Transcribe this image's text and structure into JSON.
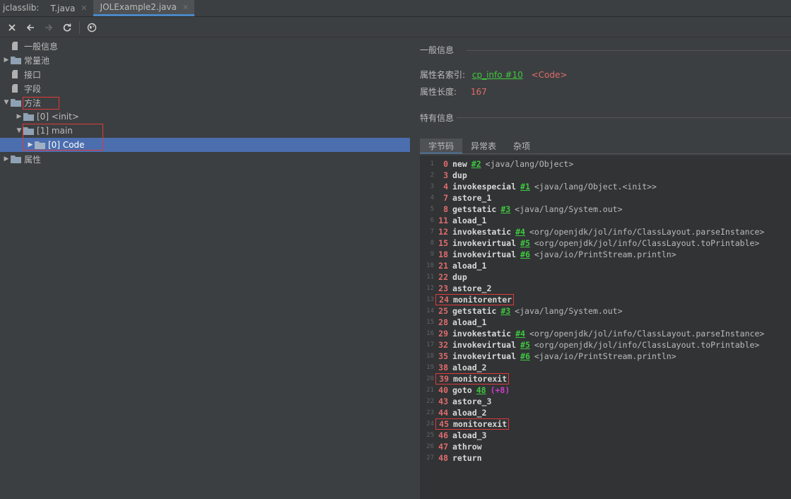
{
  "tabbar": {
    "prefix": "jclasslib:",
    "tabs": [
      {
        "label": "T.java",
        "active": false
      },
      {
        "label": "JOLExample2.java",
        "active": true
      }
    ]
  },
  "toolbar": {
    "icons": [
      "close-icon",
      "back-icon",
      "forward-icon",
      "refresh-icon",
      "browser-icon"
    ]
  },
  "tree": {
    "items": [
      {
        "label": "一般信息",
        "icon": "file-icon",
        "level": 0,
        "arrow": ""
      },
      {
        "label": "常量池",
        "icon": "folder-icon",
        "level": 0,
        "arrow": "▶"
      },
      {
        "label": "接口",
        "icon": "file-icon",
        "level": 0,
        "arrow": ""
      },
      {
        "label": "字段",
        "icon": "file-icon",
        "level": 0,
        "arrow": ""
      },
      {
        "label": "方法",
        "icon": "folder-icon",
        "level": 0,
        "arrow": "▼"
      },
      {
        "label": "[0] <init>",
        "icon": "folder-icon",
        "level": 1,
        "arrow": "▶"
      },
      {
        "label": "[1] main",
        "icon": "folder-icon",
        "level": 1,
        "arrow": "▼"
      },
      {
        "label": "[0] Code",
        "icon": "folder-icon",
        "level": 2,
        "arrow": "▶",
        "selected": true
      },
      {
        "label": "属性",
        "icon": "folder-icon",
        "level": 0,
        "arrow": "▶"
      }
    ]
  },
  "general": {
    "title": "一般信息",
    "name_index_label": "属性名索引:",
    "name_index_link": "cp_info #10",
    "name_index_value": "<Code>",
    "length_label": "属性长度:",
    "length_value": "167"
  },
  "specific": {
    "title": "特有信息",
    "tabs": [
      "字节码",
      "异常表",
      "杂项"
    ]
  },
  "bytecode": [
    {
      "ln": "1",
      "off": "0",
      "op": "new",
      "ref": "#2",
      "cmt": "<java/lang/Object>"
    },
    {
      "ln": "2",
      "off": "3",
      "op": "dup"
    },
    {
      "ln": "3",
      "off": "4",
      "op": "invokespecial",
      "ref": "#1",
      "cmt": "<java/lang/Object.<init>>"
    },
    {
      "ln": "4",
      "off": "7",
      "op": "astore_1"
    },
    {
      "ln": "5",
      "off": "8",
      "op": "getstatic",
      "ref": "#3",
      "cmt": "<java/lang/System.out>"
    },
    {
      "ln": "6",
      "off": "11",
      "op": "aload_1"
    },
    {
      "ln": "7",
      "off": "12",
      "op": "invokestatic",
      "ref": "#4",
      "cmt": "<org/openjdk/jol/info/ClassLayout.parseInstance>"
    },
    {
      "ln": "8",
      "off": "15",
      "op": "invokevirtual",
      "ref": "#5",
      "cmt": "<org/openjdk/jol/info/ClassLayout.toPrintable>"
    },
    {
      "ln": "9",
      "off": "18",
      "op": "invokevirtual",
      "ref": "#6",
      "cmt": "<java/io/PrintStream.println>"
    },
    {
      "ln": "10",
      "off": "21",
      "op": "aload_1"
    },
    {
      "ln": "11",
      "off": "22",
      "op": "dup"
    },
    {
      "ln": "12",
      "off": "23",
      "op": "astore_2"
    },
    {
      "ln": "13",
      "off": "24",
      "op": "monitorenter",
      "boxed": true
    },
    {
      "ln": "14",
      "off": "25",
      "op": "getstatic",
      "ref": "#3",
      "cmt": "<java/lang/System.out>"
    },
    {
      "ln": "15",
      "off": "28",
      "op": "aload_1"
    },
    {
      "ln": "16",
      "off": "29",
      "op": "invokestatic",
      "ref": "#4",
      "cmt": "<org/openjdk/jol/info/ClassLayout.parseInstance>"
    },
    {
      "ln": "17",
      "off": "32",
      "op": "invokevirtual",
      "ref": "#5",
      "cmt": "<org/openjdk/jol/info/ClassLayout.toPrintable>"
    },
    {
      "ln": "18",
      "off": "35",
      "op": "invokevirtual",
      "ref": "#6",
      "cmt": "<java/io/PrintStream.println>"
    },
    {
      "ln": "19",
      "off": "38",
      "op": "aload_2"
    },
    {
      "ln": "20",
      "off": "39",
      "op": "monitorexit",
      "boxed": true
    },
    {
      "ln": "21",
      "off": "40",
      "op": "goto",
      "ref": "48",
      "rel": "(+8)"
    },
    {
      "ln": "22",
      "off": "43",
      "op": "astore_3"
    },
    {
      "ln": "23",
      "off": "44",
      "op": "aload_2"
    },
    {
      "ln": "24",
      "off": "45",
      "op": "monitorexit",
      "boxed": true
    },
    {
      "ln": "25",
      "off": "46",
      "op": "aload_3"
    },
    {
      "ln": "26",
      "off": "47",
      "op": "athrow"
    },
    {
      "ln": "27",
      "off": "48",
      "op": "return"
    }
  ]
}
